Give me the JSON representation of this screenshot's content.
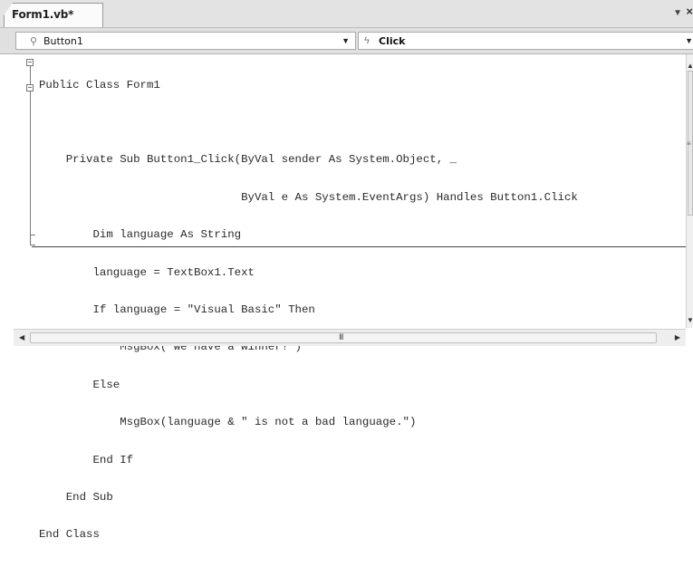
{
  "tab": {
    "title": "Form1.vb*",
    "dropdown_icon": "dropdown-arrow-icon",
    "close_icon": "close-icon"
  },
  "combos": {
    "object": {
      "value": "Button1",
      "icon": "control-icon"
    },
    "event": {
      "value": "Click",
      "icon": "lightning-icon"
    }
  },
  "code_lines": [
    "Public Class Form1",
    "",
    "    Private Sub Button1_Click(ByVal sender As System.Object, _",
    "                              ByVal e As System.EventArgs) Handles Button1.Click",
    "        Dim language As String",
    "        language = TextBox1.Text",
    "        If language = \"Visual Basic\" Then",
    "            MsgBox(\"We have a winner!\")",
    "        Else",
    "            MsgBox(language & \" is not a bad language.\")",
    "        End If",
    "    End Sub",
    "End Class"
  ],
  "scrollbar": {
    "h_grip": "III",
    "v_grip": "≡"
  }
}
